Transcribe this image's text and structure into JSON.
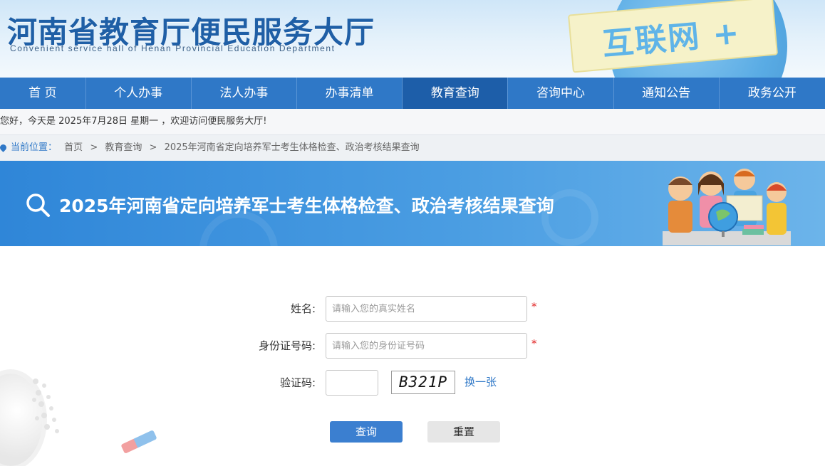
{
  "header": {
    "title": "河南省教育厅便民服务大厅",
    "subtitle": "Convenient service hall of Henan Provincial Education Department",
    "banner_text": "互联网 +"
  },
  "nav": {
    "items": [
      {
        "label": "首 页"
      },
      {
        "label": "个人办事"
      },
      {
        "label": "法人办事"
      },
      {
        "label": "办事清单"
      },
      {
        "label": "教育查询"
      },
      {
        "label": "咨询中心"
      },
      {
        "label": "通知公告"
      },
      {
        "label": "政务公开"
      }
    ],
    "active_index": 4
  },
  "welcome": {
    "text": "您好，今天是 2025年7月28日 星期一 ，欢迎访问便民服务大厅!"
  },
  "breadcrumb": {
    "label": "当前位置：",
    "items": [
      "首页",
      ">",
      "教育查询",
      ">",
      "2025年河南省定向培养军士考生体格检查、政治考核结果查询"
    ]
  },
  "banner": {
    "title": "2025年河南省定向培养军士考生体格检查、政治考核结果查询"
  },
  "form": {
    "name": {
      "label": "姓名:",
      "placeholder": "请输入您的真实姓名",
      "required_mark": "*"
    },
    "id_number": {
      "label": "身份证号码:",
      "placeholder": "请输入您的身份证号码",
      "required_mark": "*"
    },
    "captcha": {
      "label": "验证码:",
      "image_text": "B321P",
      "refresh_label": "换一张"
    },
    "query_label": "查询",
    "reset_label": "重置"
  },
  "colors": {
    "nav_bg": "#2f78c7",
    "nav_active": "#1d5ea9",
    "banner_bg": "#3a90dd",
    "accent_red": "#e02020",
    "button_blue": "#3b7fd0"
  },
  "icons": [
    "search-icon",
    "location-pin-icon"
  ]
}
